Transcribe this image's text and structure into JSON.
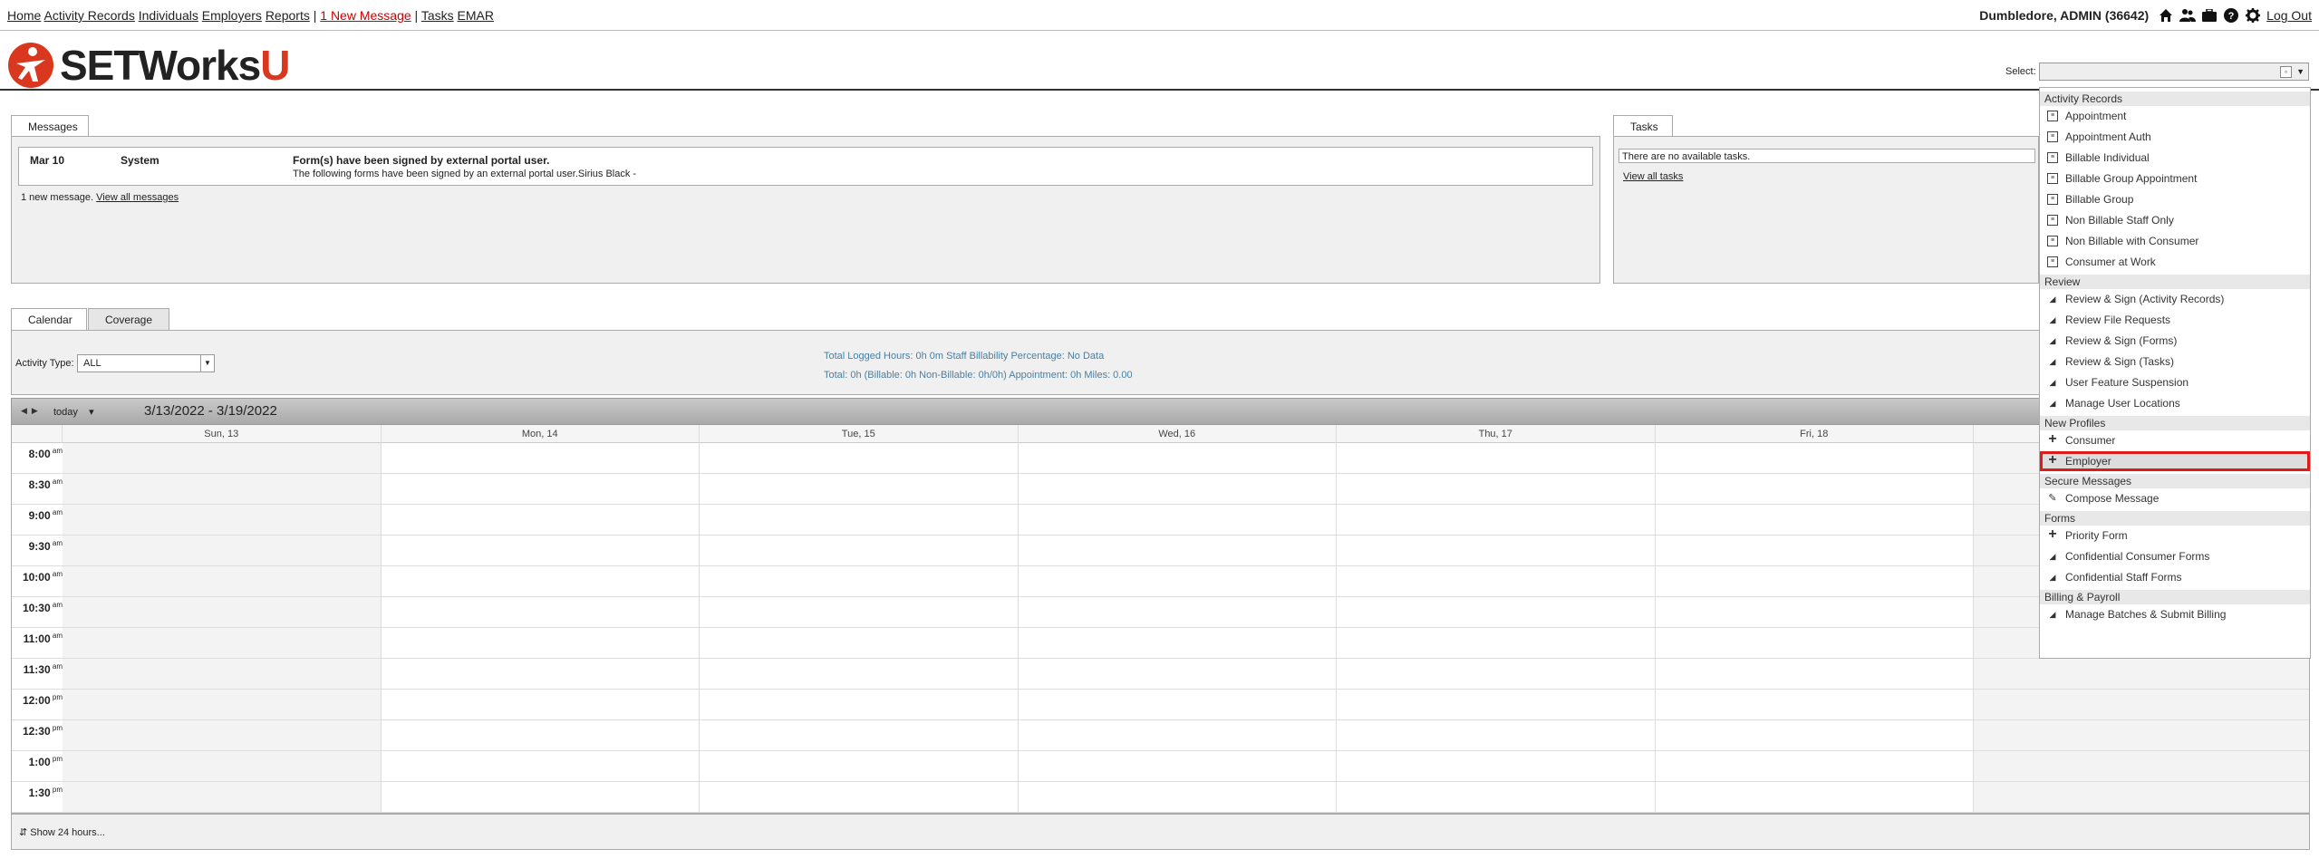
{
  "topnav": {
    "home": "Home",
    "activity_records": "Activity Records",
    "individuals": "Individuals",
    "employers": "Employers",
    "reports": "Reports",
    "sep": "|",
    "new_message": "1 New Message",
    "tasks": "Tasks",
    "emar": "EMAR",
    "user": "Dumbledore, ADMIN (36642)",
    "logout": "Log Out",
    "icons": [
      "home-icon",
      "people-icon",
      "briefcase-icon",
      "help-icon",
      "gear-icon"
    ]
  },
  "logo": {
    "word": "SETWorks",
    "u": "U"
  },
  "select": {
    "label": "Select:"
  },
  "messages": {
    "tab": "Messages",
    "date": "Mar 10",
    "from": "System",
    "subject": "Form(s) have been signed by external portal user.",
    "body": "The following forms have been signed by an external portal user.Sirius Black -",
    "count_text": "1 new message.",
    "view_all": "View all messages"
  },
  "tasks": {
    "tab": "Tasks",
    "empty": "There are no available tasks.",
    "view_all": "View all tasks"
  },
  "calendar": {
    "tab_calendar": "Calendar",
    "tab_coverage": "Coverage",
    "activity_type_label": "Activity Type:",
    "activity_type_value": "ALL",
    "stats_line1": "Total Logged Hours: 0h 0m   Staff Billability Percentage: No Data",
    "stats_line2": "Total: 0h  (Billable: 0h  Non-Billable: 0h/0h)  Appointment: 0h  Miles: 0.00",
    "today": "today",
    "range": "3/13/2022 - 3/19/2022",
    "days": [
      "Sun, 13",
      "Mon, 14",
      "Tue, 15",
      "Wed, 16",
      "Thu, 17",
      "Fri, 18"
    ],
    "times": [
      {
        "t": "8:00",
        "p": "am"
      },
      {
        "t": "8:30",
        "p": "am"
      },
      {
        "t": "9:00",
        "p": "am"
      },
      {
        "t": "9:30",
        "p": "am"
      },
      {
        "t": "10:00",
        "p": "am"
      },
      {
        "t": "10:30",
        "p": "am"
      },
      {
        "t": "11:00",
        "p": "am"
      },
      {
        "t": "11:30",
        "p": "am"
      },
      {
        "t": "12:00",
        "p": "pm"
      },
      {
        "t": "12:30",
        "p": "pm"
      },
      {
        "t": "1:00",
        "p": "pm"
      },
      {
        "t": "1:30",
        "p": "pm"
      }
    ],
    "show_24": "Show 24 hours..."
  },
  "dropdown": {
    "groups": [
      {
        "label": "Activity Records",
        "items": [
          {
            "label": "Appointment",
            "icon": "doc"
          },
          {
            "label": "Appointment Auth",
            "icon": "doc"
          },
          {
            "label": "Billable Individual",
            "icon": "doc"
          },
          {
            "label": "Billable Group Appointment",
            "icon": "doc"
          },
          {
            "label": "Billable Group",
            "icon": "doc"
          },
          {
            "label": "Non Billable Staff Only",
            "icon": "doc"
          },
          {
            "label": "Non Billable with Consumer",
            "icon": "doc"
          },
          {
            "label": "Consumer at Work",
            "icon": "doc"
          }
        ]
      },
      {
        "label": "Review",
        "items": [
          {
            "label": "Review & Sign (Activity Records)",
            "icon": "tri"
          },
          {
            "label": "Review File Requests",
            "icon": "tri"
          },
          {
            "label": "Review & Sign (Forms)",
            "icon": "tri"
          },
          {
            "label": "Review & Sign (Tasks)",
            "icon": "tri"
          },
          {
            "label": "User Feature Suspension",
            "icon": "tri"
          },
          {
            "label": "Manage User Locations",
            "icon": "tri"
          }
        ]
      },
      {
        "label": "New Profiles",
        "items": [
          {
            "label": "Consumer",
            "icon": "plus"
          },
          {
            "label": "Employer",
            "icon": "plus",
            "highlighted": true
          }
        ]
      },
      {
        "label": "Secure Messages",
        "items": [
          {
            "label": "Compose Message",
            "icon": "compose"
          }
        ]
      },
      {
        "label": "Forms",
        "items": [
          {
            "label": "Priority Form",
            "icon": "plus"
          },
          {
            "label": "Confidential Consumer Forms",
            "icon": "tri"
          },
          {
            "label": "Confidential Staff Forms",
            "icon": "tri"
          }
        ]
      },
      {
        "label": "Billing & Payroll",
        "items": [
          {
            "label": "Manage Batches & Submit Billing",
            "icon": "tri"
          }
        ]
      }
    ]
  }
}
